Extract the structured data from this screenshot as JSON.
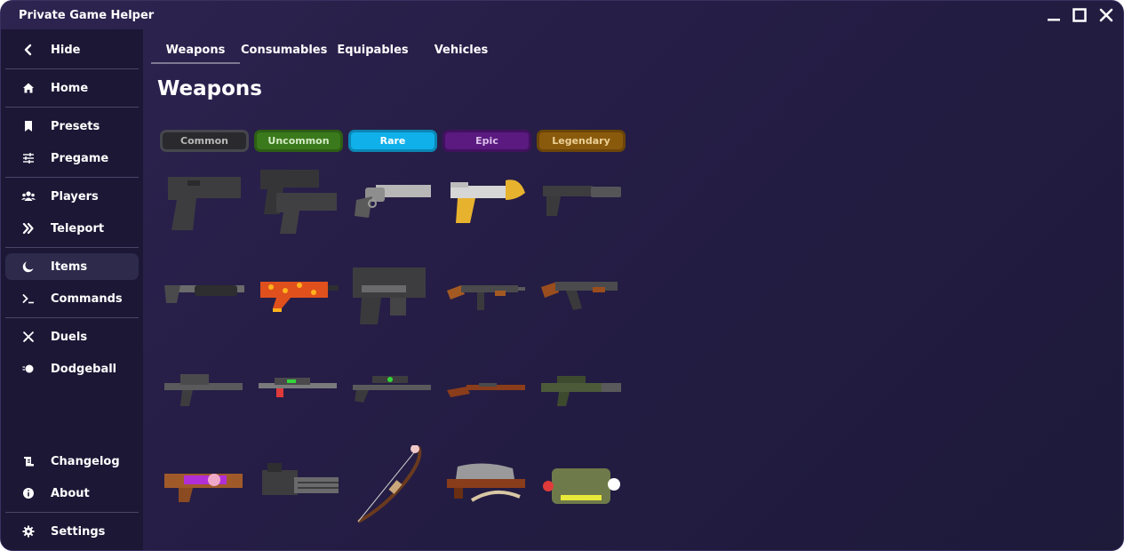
{
  "window": {
    "title": "Private Game Helper",
    "minimize_icon": "minimize-icon",
    "maximize_icon": "maximize-icon",
    "close_icon": "close-icon"
  },
  "sidebar": {
    "items": [
      {
        "label": "Hide",
        "icon": "chevron-left-icon"
      },
      {
        "label": "Home",
        "icon": "home-icon"
      },
      {
        "label": "Presets",
        "icon": "bookmark-icon"
      },
      {
        "label": "Pregame",
        "icon": "sliders-icon"
      },
      {
        "label": "Players",
        "icon": "users-icon"
      },
      {
        "label": "Teleport",
        "icon": "double-chevron-right-icon"
      },
      {
        "label": "Items",
        "icon": "moon-icon",
        "active": true
      },
      {
        "label": "Commands",
        "icon": "terminal-icon"
      },
      {
        "label": "Duels",
        "icon": "crossed-swords-icon"
      },
      {
        "label": "Dodgeball",
        "icon": "ball-icon"
      },
      {
        "label": "Changelog",
        "icon": "scroll-icon"
      },
      {
        "label": "About",
        "icon": "info-icon"
      },
      {
        "label": "Settings",
        "icon": "gear-icon"
      }
    ]
  },
  "tabs": [
    {
      "label": "Weapons",
      "active": true
    },
    {
      "label": "Consumables"
    },
    {
      "label": "Equipables"
    },
    {
      "label": "Vehicles"
    }
  ],
  "main": {
    "title": "Weapons"
  },
  "rarities": [
    {
      "label": "Common",
      "bg": "#2a2a2e",
      "border": "#4a4a50",
      "text": "#b8b8b8"
    },
    {
      "label": "Uncommon",
      "bg": "#3b7a1c",
      "border": "#2c5e14",
      "text": "#cfe7c2"
    },
    {
      "label": "Rare",
      "bg": "#10b0ea",
      "border": "#0b86b4",
      "text": "#ffffff"
    },
    {
      "label": "Epic",
      "bg": "#5a1a80",
      "border": "#41115e",
      "text": "#d7b8e8"
    },
    {
      "label": "Legendary",
      "bg": "#8a5a0c",
      "border": "#6b4508",
      "text": "#e8c98a"
    }
  ],
  "weapons": [
    [
      "pistol-icon",
      "dual-pistols-icon",
      "revolver-icon",
      "eagle-pistol-icon",
      "silenced-pistol-icon"
    ],
    [
      "shotgun-icon",
      "lava-smg-icon",
      "grenade-launcher-icon",
      "tommy-gun-icon",
      "ak-rifle-icon"
    ],
    [
      "m4-rifle-icon",
      "laser-sniper-icon",
      "scoped-rifle-icon",
      "hunting-rifle-icon",
      "suppressed-rifle-icon"
    ],
    [
      "plasma-gun-icon",
      "minigun-icon",
      "bow-icon",
      "crossbow-icon",
      "rpg-launcher-icon"
    ]
  ],
  "colors": {
    "accent": "#7d7894",
    "sidebar_bg": "#1b1735",
    "window_bg": "#2d2450"
  }
}
